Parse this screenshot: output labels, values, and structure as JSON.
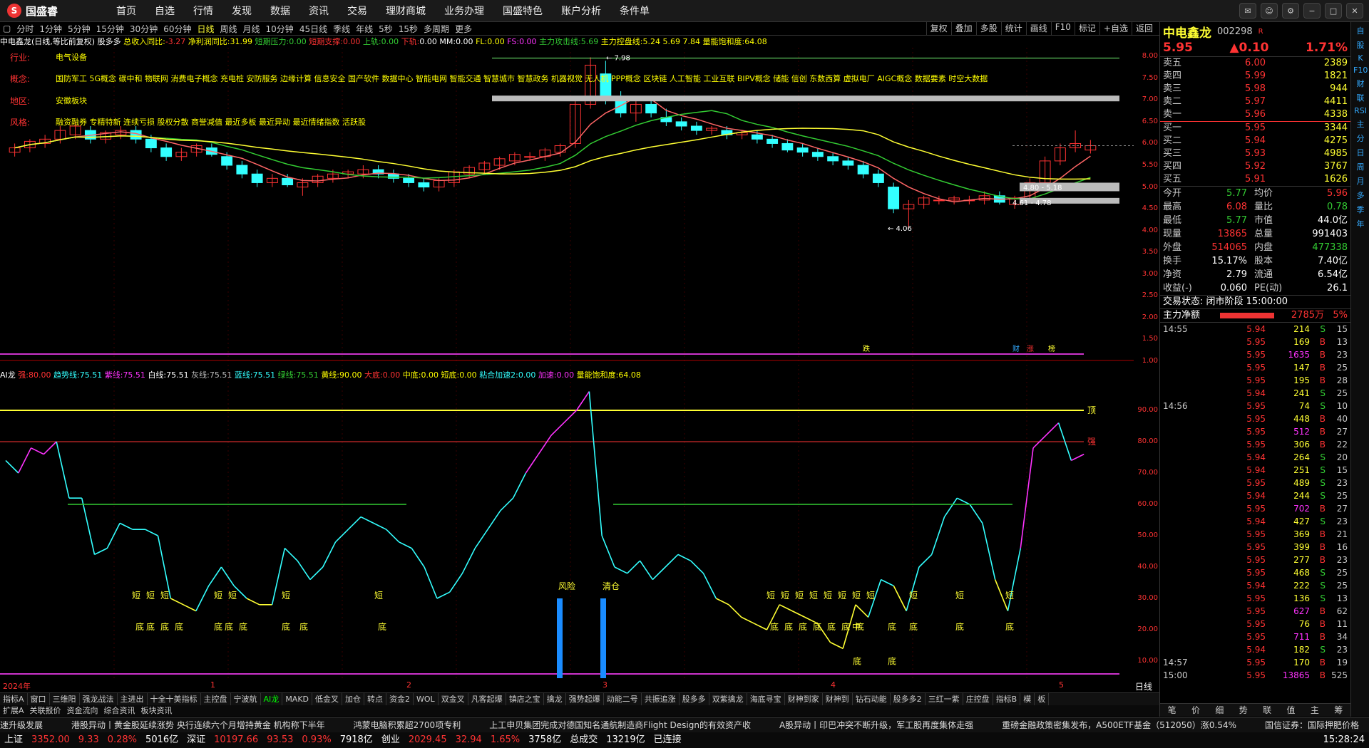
{
  "app": {
    "logo_text": "国盛睿"
  },
  "menu": [
    "首页",
    "自选",
    "行情",
    "发现",
    "数据",
    "资讯",
    "交易",
    "理财商城",
    "业务办理",
    "国盛特色",
    "账户分析",
    "条件单"
  ],
  "window_controls": [
    "消息",
    "客服",
    "设置",
    "最小",
    "还原",
    "关闭"
  ],
  "periods": [
    "分时",
    "1分钟",
    "5分钟",
    "15分钟",
    "30分钟",
    "60分钟",
    "日线",
    "周线",
    "月线",
    "10分钟",
    "45日线",
    "季线",
    "年线",
    "5秒",
    "15秒",
    "多周期",
    "更多"
  ],
  "active_period": "日线",
  "right_tools": [
    "复权",
    "叠加",
    "多股",
    "统计",
    "画线",
    "F10",
    "标记",
    "+自选",
    "返回"
  ],
  "info_line": {
    "stock": "中电鑫龙(日线,等比前复权)",
    "formula": "股多多",
    "income_label": "总收入同比:",
    "income_val": "-3.27",
    "profit_label": "净利润同比:",
    "profit_val": "31.99",
    "short_pressure_label": "短期压力:",
    "short_pressure_val": "0.00",
    "short_support_label": "短期支撑:",
    "short_support_val": "0.00",
    "up_label": "上轨:",
    "up_val": "0.00",
    "down_label": "下轨:",
    "down_val": "0.00",
    "mm_label": "MM:",
    "mm_val": "0.00",
    "fl_label": "FL:",
    "fl_val": "0.00",
    "fs_label": "FS:",
    "fs_val": "0.00",
    "attack_label": "主力攻击线:",
    "attack_val": "5.69",
    "control_label": "主力控盘线:",
    "control_val": "5.24",
    "v1": "5.69",
    "v2": "7.84",
    "energy_label": "量能饱和度:",
    "energy_val": "64.08"
  },
  "overlay": {
    "industry_tag": "行业:",
    "industry": "电气设备",
    "concept_tag": "概念:",
    "concepts": "国防军工 5G概念 碳中和 物联网 消费电子概念 充电桩 安防服务 边缘计算 信息安全 国产软件 数据中心 智能电网 智能交通 智慧城市 智慧政务 机器视觉 无人机 PPP概念 区块链 人工智能 工业互联 BIPV概念 储能 信创 东数西算 虚拟电厂 AIGC概念 数据要素 时空大数据",
    "region_tag": "地区:",
    "region": "安徽板块",
    "style_tag": "风格:",
    "styles": "融资融券 专精特新 连续亏损 股权分散 商誉减值 最近多板 最近异动 最近情绪指数 活跃股"
  },
  "main_axis": [
    "8.00",
    "7.50",
    "7.00",
    "6.50",
    "6.00",
    "5.50",
    "5.00",
    "4.50",
    "4.00",
    "3.50",
    "3.00",
    "2.50",
    "2.00",
    "1.50",
    "1.00"
  ],
  "annotations": {
    "high": "7.98",
    "low": "4.06",
    "range1": "4.80 - 5.18",
    "range2": "4.61 - 4.78",
    "events": [
      "跌",
      "财",
      "涨",
      "榜"
    ]
  },
  "sub_info": {
    "name": "AI龙",
    "strong_label": "强:",
    "strong_val": "80.00",
    "trend_label": "趋势线:",
    "trend_val": "75.51",
    "purple_label": "紫线:",
    "purple_val": "75.51",
    "white_label": "白线:",
    "white_val": "75.51",
    "grey_label": "灰线:",
    "grey_val": "75.51",
    "blue_label": "蓝线:",
    "blue_val": "75.51",
    "green_label": "绿线:",
    "green_val": "75.51",
    "yellow_label": "黄线:",
    "yellow_val": "90.00",
    "top_label": "大底:",
    "top_val": "0.00",
    "mid_label": "中底:",
    "mid_val": "0.00",
    "short_label": "短底:",
    "short_val": "0.00",
    "accel2_label": "粘合加速2:",
    "accel2_val": "0.00",
    "accel_label": "加速:",
    "accel_val": "0.00",
    "energy_label": "量能饱和度:",
    "energy_val": "64.08"
  },
  "sub_axis": [
    "90.00",
    "80.00",
    "70.00",
    "60.00",
    "50.00",
    "40.00",
    "30.00",
    "20.00",
    "10.00"
  ],
  "sub_labels": {
    "top": "顶",
    "strong": "强",
    "risk": "风险",
    "clear": "清仓",
    "short_bottom": "短",
    "bottom": "底",
    "mid": "中"
  },
  "x_labels": [
    "2024年",
    "1",
    "2",
    "3",
    "4",
    "5"
  ],
  "x_axis_period": "日线",
  "bottom_tabs": [
    "指标A",
    "窗口",
    "三维阳",
    "强龙战法",
    "主进出",
    "十全十美指标",
    "主控盘",
    "宁波航",
    "AI龙",
    "MAKD",
    "低金叉",
    "加仓",
    "转点",
    "资金2",
    "WOL",
    "双金叉",
    "凡客起爆",
    "镇店之宝",
    "擒龙",
    "强势起爆",
    "动能二号",
    "共振追涨",
    "股多多",
    "双紫擒龙",
    "海底寻宝",
    "财神到家",
    "财神到",
    "钻石动能",
    "股多多2",
    "三红一紫",
    "庄控盘",
    "指标B",
    "模",
    "板"
  ],
  "active_tab": "AI龙",
  "bottom_tabs2": [
    "扩展A",
    "关联报价",
    "资金流向",
    "综合资讯",
    "板块资讯"
  ],
  "ticker": [
    "速升级发展",
    "港股异动丨黄金股延续涨势 央行连续六个月增持黄金 机构称下半年",
    "鸿蒙电脑积累超2700项专利",
    "上工申贝集团完成对德国知名通航制造商Flight Design的有效资产收",
    "A股异动丨印巴冲突不断升级，军工股再度集体走强",
    "重磅金融政策密集发布，A500ETF基金（512050）涨0.54%",
    "国信证券：国际押肥价格"
  ],
  "status": {
    "sh_label": "上证",
    "sh_val": "3352.00",
    "sh_chg": "9.33",
    "sh_pct": "0.28%",
    "sh_amt": "5016亿",
    "sz_label": "深证",
    "sz_val": "10197.66",
    "sz_chg": "93.53",
    "sz_pct": "0.93%",
    "sz_amt": "7918亿",
    "cy_label": "创业",
    "cy_val": "2029.45",
    "cy_chg": "32.94",
    "cy_pct": "1.65%",
    "cy_amt": "3758亿",
    "total_label": "总成交",
    "total_val": "13219亿",
    "conn": "已连接",
    "time": "15:28:24"
  },
  "quote": {
    "name": "中电鑫龙",
    "code": "002298",
    "mark": "R",
    "price": "5.95",
    "change": "▲0.10",
    "pct": "1.71%",
    "asks": [
      {
        "label": "卖五",
        "price": "6.00",
        "vol": "2389"
      },
      {
        "label": "卖四",
        "price": "5.99",
        "vol": "1821"
      },
      {
        "label": "卖三",
        "price": "5.98",
        "vol": "944"
      },
      {
        "label": "卖二",
        "price": "5.97",
        "vol": "4411"
      },
      {
        "label": "卖一",
        "price": "5.96",
        "vol": "4338"
      }
    ],
    "bids": [
      {
        "label": "买一",
        "price": "5.95",
        "vol": "3344"
      },
      {
        "label": "买二",
        "price": "5.94",
        "vol": "4275"
      },
      {
        "label": "买三",
        "price": "5.93",
        "vol": "4985"
      },
      {
        "label": "买四",
        "price": "5.92",
        "vol": "3767"
      },
      {
        "label": "买五",
        "price": "5.91",
        "vol": "1626"
      }
    ],
    "stats": [
      {
        "k": "今开",
        "v": "5.77",
        "vc": "#3c3",
        "k2": "均价",
        "v2": "5.96",
        "v2c": "#f33"
      },
      {
        "k": "最高",
        "v": "6.08",
        "vc": "#f33",
        "k2": "量比",
        "v2": "0.78",
        "v2c": "#3c3"
      },
      {
        "k": "最低",
        "v": "5.77",
        "vc": "#3c3",
        "k2": "市值",
        "v2": "44.0亿",
        "v2c": "#fff"
      },
      {
        "k": "现量",
        "v": "13865",
        "vc": "#f33",
        "k2": "总量",
        "v2": "991403",
        "v2c": "#fff"
      },
      {
        "k": "外盘",
        "v": "514065",
        "vc": "#f33",
        "k2": "内盘",
        "v2": "477338",
        "v2c": "#3c3"
      },
      {
        "k": "换手",
        "v": "15.17%",
        "vc": "#fff",
        "k2": "股本",
        "v2": "7.40亿",
        "v2c": "#fff"
      },
      {
        "k": "净资",
        "v": "2.79",
        "vc": "#fff",
        "k2": "流通",
        "v2": "6.54亿",
        "v2c": "#fff"
      },
      {
        "k": "收益(-)",
        "v": "0.060",
        "vc": "#fff",
        "k2": "PE(动)",
        "v2": "26.1",
        "v2c": "#fff"
      }
    ],
    "trade_status": "交易状态: 闭市阶段 15:00:00",
    "net_label": "主力净额",
    "net_val": "2785万",
    "net_pct": "5%",
    "trades": [
      {
        "t": "14:55",
        "p": "5.94",
        "v": "214",
        "bs": "S",
        "n": "15"
      },
      {
        "t": "",
        "p": "5.95",
        "v": "169",
        "bs": "B",
        "n": "13"
      },
      {
        "t": "",
        "p": "5.95",
        "v": "1635",
        "bs": "B",
        "n": "23"
      },
      {
        "t": "",
        "p": "5.95",
        "v": "147",
        "bs": "B",
        "n": "25"
      },
      {
        "t": "",
        "p": "5.95",
        "v": "195",
        "bs": "B",
        "n": "28"
      },
      {
        "t": "",
        "p": "5.94",
        "v": "241",
        "bs": "S",
        "n": "25"
      },
      {
        "t": "14:56",
        "p": "5.95",
        "v": "74",
        "bs": "S",
        "n": "10"
      },
      {
        "t": "",
        "p": "5.95",
        "v": "448",
        "bs": "B",
        "n": "40"
      },
      {
        "t": "",
        "p": "5.95",
        "v": "512",
        "bs": "B",
        "n": "27"
      },
      {
        "t": "",
        "p": "5.95",
        "v": "306",
        "bs": "B",
        "n": "22"
      },
      {
        "t": "",
        "p": "5.94",
        "v": "264",
        "bs": "S",
        "n": "20"
      },
      {
        "t": "",
        "p": "5.94",
        "v": "251",
        "bs": "S",
        "n": "15"
      },
      {
        "t": "",
        "p": "5.95",
        "v": "489",
        "bs": "S",
        "n": "23"
      },
      {
        "t": "",
        "p": "5.94",
        "v": "244",
        "bs": "S",
        "n": "25"
      },
      {
        "t": "",
        "p": "5.95",
        "v": "702",
        "bs": "B",
        "n": "27"
      },
      {
        "t": "",
        "p": "5.94",
        "v": "427",
        "bs": "S",
        "n": "23"
      },
      {
        "t": "",
        "p": "5.95",
        "v": "369",
        "bs": "B",
        "n": "21"
      },
      {
        "t": "",
        "p": "5.95",
        "v": "399",
        "bs": "B",
        "n": "16"
      },
      {
        "t": "",
        "p": "5.95",
        "v": "277",
        "bs": "B",
        "n": "23"
      },
      {
        "t": "",
        "p": "5.95",
        "v": "468",
        "bs": "S",
        "n": "25"
      },
      {
        "t": "",
        "p": "5.94",
        "v": "222",
        "bs": "S",
        "n": "25"
      },
      {
        "t": "",
        "p": "5.95",
        "v": "136",
        "bs": "S",
        "n": "13"
      },
      {
        "t": "",
        "p": "5.95",
        "v": "627",
        "bs": "B",
        "n": "62"
      },
      {
        "t": "",
        "p": "5.95",
        "v": "76",
        "bs": "B",
        "n": "11"
      },
      {
        "t": "",
        "p": "5.95",
        "v": "711",
        "bs": "B",
        "n": "34"
      },
      {
        "t": "",
        "p": "5.94",
        "v": "182",
        "bs": "S",
        "n": "23"
      },
      {
        "t": "14:57",
        "p": "5.95",
        "v": "170",
        "bs": "B",
        "n": "19"
      },
      {
        "t": "15:00",
        "p": "5.95",
        "v": "13865",
        "bs": "B",
        "n": "525"
      }
    ],
    "bottom_tabs": [
      "笔",
      "价",
      "细",
      "势",
      "联",
      "值",
      "主",
      "筹"
    ]
  },
  "sidebar": [
    "自",
    "股",
    "K",
    "F10",
    "财",
    "联",
    "RSI",
    "主",
    "分",
    "日",
    "周",
    "月",
    "多",
    "季",
    "年"
  ],
  "chart_data": {
    "type": "candlestick",
    "title": "中电鑫龙(日线,等比前复权)",
    "x_start_label": "2024年",
    "month_marks": [
      "1",
      "2",
      "3",
      "4",
      "5"
    ],
    "ylim": [
      1.0,
      8.2
    ],
    "price_candles_approx": [
      [
        5.8,
        6.0,
        5.7,
        5.9
      ],
      [
        5.9,
        6.1,
        5.8,
        6.05
      ],
      [
        6.0,
        6.2,
        5.9,
        6.1
      ],
      [
        6.1,
        6.4,
        6.0,
        6.3
      ],
      [
        6.2,
        6.5,
        6.1,
        6.4
      ],
      [
        6.3,
        6.4,
        6.0,
        6.1
      ],
      [
        6.1,
        6.3,
        6.0,
        6.25
      ],
      [
        6.2,
        6.4,
        6.1,
        6.3
      ],
      [
        6.3,
        6.4,
        6.0,
        6.1
      ],
      [
        6.1,
        6.2,
        5.8,
        5.9
      ],
      [
        5.9,
        6.0,
        5.6,
        5.7
      ],
      [
        5.7,
        5.9,
        5.6,
        5.8
      ],
      [
        5.8,
        6.0,
        5.7,
        5.95
      ],
      [
        5.9,
        6.0,
        5.7,
        5.75
      ],
      [
        5.7,
        5.8,
        5.4,
        5.5
      ],
      [
        5.5,
        5.6,
        5.2,
        5.3
      ],
      [
        5.3,
        5.4,
        5.0,
        5.1
      ],
      [
        5.1,
        5.3,
        5.0,
        5.2
      ],
      [
        5.2,
        5.3,
        5.0,
        5.05
      ],
      [
        5.0,
        5.2,
        4.8,
        5.1
      ],
      [
        5.1,
        5.3,
        5.0,
        5.25
      ],
      [
        5.2,
        5.4,
        5.1,
        5.3
      ],
      [
        5.3,
        5.4,
        5.2,
        5.35
      ],
      [
        5.3,
        5.5,
        5.2,
        5.4
      ],
      [
        5.4,
        5.5,
        5.2,
        5.3
      ],
      [
        5.3,
        5.4,
        5.1,
        5.2
      ],
      [
        5.2,
        5.3,
        5.0,
        5.1
      ],
      [
        5.1,
        5.2,
        4.9,
        5.0
      ],
      [
        5.0,
        5.2,
        4.9,
        5.15
      ],
      [
        5.1,
        5.4,
        5.0,
        5.35
      ],
      [
        5.3,
        5.5,
        5.2,
        5.45
      ],
      [
        5.4,
        5.6,
        5.3,
        5.55
      ],
      [
        5.5,
        5.7,
        5.4,
        5.65
      ],
      [
        5.6,
        5.8,
        5.5,
        5.75
      ],
      [
        5.7,
        5.8,
        5.6,
        5.7
      ],
      [
        5.7,
        5.9,
        5.6,
        5.85
      ],
      [
        5.8,
        6.0,
        5.7,
        5.95
      ],
      [
        6.0,
        7.0,
        5.9,
        6.9
      ],
      [
        6.9,
        7.98,
        6.8,
        7.8
      ],
      [
        7.6,
        7.9,
        6.9,
        7.0
      ],
      [
        7.0,
        7.2,
        6.6,
        6.7
      ],
      [
        6.7,
        7.0,
        6.5,
        6.9
      ],
      [
        6.9,
        7.0,
        6.6,
        6.7
      ],
      [
        6.6,
        6.8,
        6.4,
        6.5
      ],
      [
        6.5,
        6.6,
        6.3,
        6.4
      ],
      [
        6.4,
        6.5,
        6.2,
        6.3
      ],
      [
        6.3,
        6.4,
        6.2,
        6.35
      ],
      [
        6.3,
        6.4,
        6.1,
        6.2
      ],
      [
        6.2,
        6.3,
        6.1,
        6.25
      ],
      [
        6.2,
        6.3,
        6.0,
        6.1
      ],
      [
        6.1,
        6.2,
        5.9,
        6.0
      ],
      [
        6.0,
        6.1,
        5.8,
        5.85
      ],
      [
        5.9,
        6.0,
        5.7,
        5.8
      ],
      [
        5.8,
        5.9,
        5.6,
        5.7
      ],
      [
        5.7,
        5.8,
        5.5,
        5.6
      ],
      [
        5.6,
        5.7,
        5.4,
        5.5
      ],
      [
        5.5,
        5.6,
        5.2,
        5.3
      ],
      [
        5.3,
        5.4,
        5.0,
        5.1
      ],
      [
        5.0,
        5.1,
        4.4,
        4.5
      ],
      [
        4.5,
        4.7,
        4.06,
        4.6
      ],
      [
        4.6,
        4.8,
        4.5,
        4.75
      ],
      [
        4.7,
        4.8,
        4.6,
        4.7
      ],
      [
        4.7,
        4.8,
        4.6,
        4.75
      ],
      [
        4.7,
        4.8,
        4.6,
        4.7
      ],
      [
        4.7,
        4.9,
        4.6,
        4.8
      ],
      [
        4.8,
        4.9,
        4.6,
        4.65
      ],
      [
        4.6,
        4.8,
        4.5,
        4.75
      ],
      [
        4.7,
        5.2,
        4.7,
        5.1
      ],
      [
        5.1,
        5.7,
        5.0,
        5.6
      ],
      [
        5.6,
        6.0,
        5.5,
        5.9
      ],
      [
        5.9,
        6.3,
        5.8,
        6.0
      ],
      [
        5.85,
        6.08,
        5.77,
        5.95
      ]
    ],
    "ai_long_approx": [
      74,
      70,
      78,
      76,
      80,
      62,
      62,
      44,
      46,
      54,
      52,
      52,
      50,
      30,
      28,
      26,
      34,
      40,
      34,
      30,
      28,
      28,
      46,
      42,
      36,
      40,
      48,
      52,
      56,
      54,
      52,
      48,
      46,
      40,
      30,
      32,
      38,
      46,
      52,
      58,
      62,
      70,
      76,
      82,
      86,
      90,
      96,
      50,
      40,
      38,
      42,
      36,
      40,
      44,
      42,
      38,
      30,
      28,
      24,
      22,
      20,
      28,
      26,
      24,
      22,
      16,
      14,
      28,
      24,
      36,
      34,
      26,
      40,
      44,
      56,
      62,
      60,
      54,
      36,
      26,
      46,
      78,
      82,
      86,
      74,
      76
    ]
  }
}
